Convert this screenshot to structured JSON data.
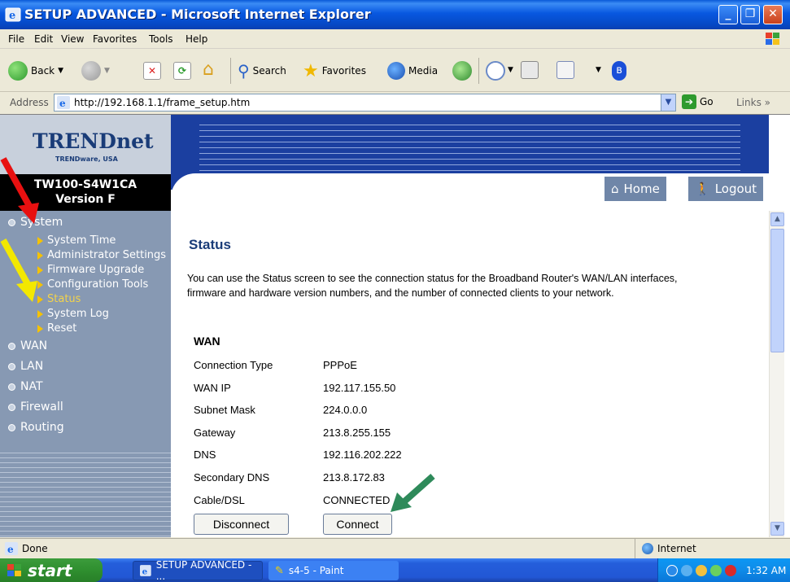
{
  "window": {
    "title": "SETUP ADVANCED - Microsoft Internet Explorer"
  },
  "menu": [
    "File",
    "Edit",
    "View",
    "Favorites",
    "Tools",
    "Help"
  ],
  "toolbar": {
    "back": "Back",
    "search": "Search",
    "favorites": "Favorites",
    "media": "Media"
  },
  "address": {
    "label": "Address",
    "url": "http://192.168.1.1/frame_setup.htm",
    "go": "Go",
    "links": "Links"
  },
  "sidebar": {
    "brand": "TRENDnet",
    "brand_sub": "TRENDware, USA",
    "model": "TW100-S4W1CA",
    "version": "Version F",
    "system": "System",
    "system_items": [
      "System Time",
      "Administrator Settings",
      "Firmware Upgrade",
      "Configuration Tools",
      "Status",
      "System Log",
      "Reset"
    ],
    "sections": [
      "WAN",
      "LAN",
      "NAT",
      "Firewall",
      "Routing"
    ]
  },
  "header": {
    "home": "Home",
    "logout": "Logout"
  },
  "main": {
    "title": "Status",
    "description": "You can use the Status screen to see the connection status for the Broadband Router's WAN/LAN interfaces, firmware and hardware version numbers, and the number of connected clients to your network.",
    "section": "WAN",
    "rows": [
      {
        "key": "Connection Type",
        "value": "PPPoE"
      },
      {
        "key": "WAN IP",
        "value": "192.117.155.50"
      },
      {
        "key": "Subnet Mask",
        "value": "224.0.0.0"
      },
      {
        "key": "Gateway",
        "value": "213.8.255.155"
      },
      {
        "key": "DNS",
        "value": "192.116.202.222"
      },
      {
        "key": "Secondary DNS",
        "value": "213.8.172.83"
      },
      {
        "key": "Cable/DSL",
        "value": "CONNECTED"
      }
    ],
    "disconnect": "Disconnect",
    "connect": "Connect"
  },
  "statusbar": {
    "left": "Done",
    "zone": "Internet"
  },
  "taskbar": {
    "start": "start",
    "tasks": [
      "SETUP ADVANCED - ...",
      "s4-5 - Paint"
    ],
    "clock": "1:32 AM"
  },
  "colors": {
    "header_blue": "#1b3fa0",
    "sidebar": "#8799b3",
    "active_item": "#f3d34a",
    "title_blue": "#1a3c78"
  }
}
